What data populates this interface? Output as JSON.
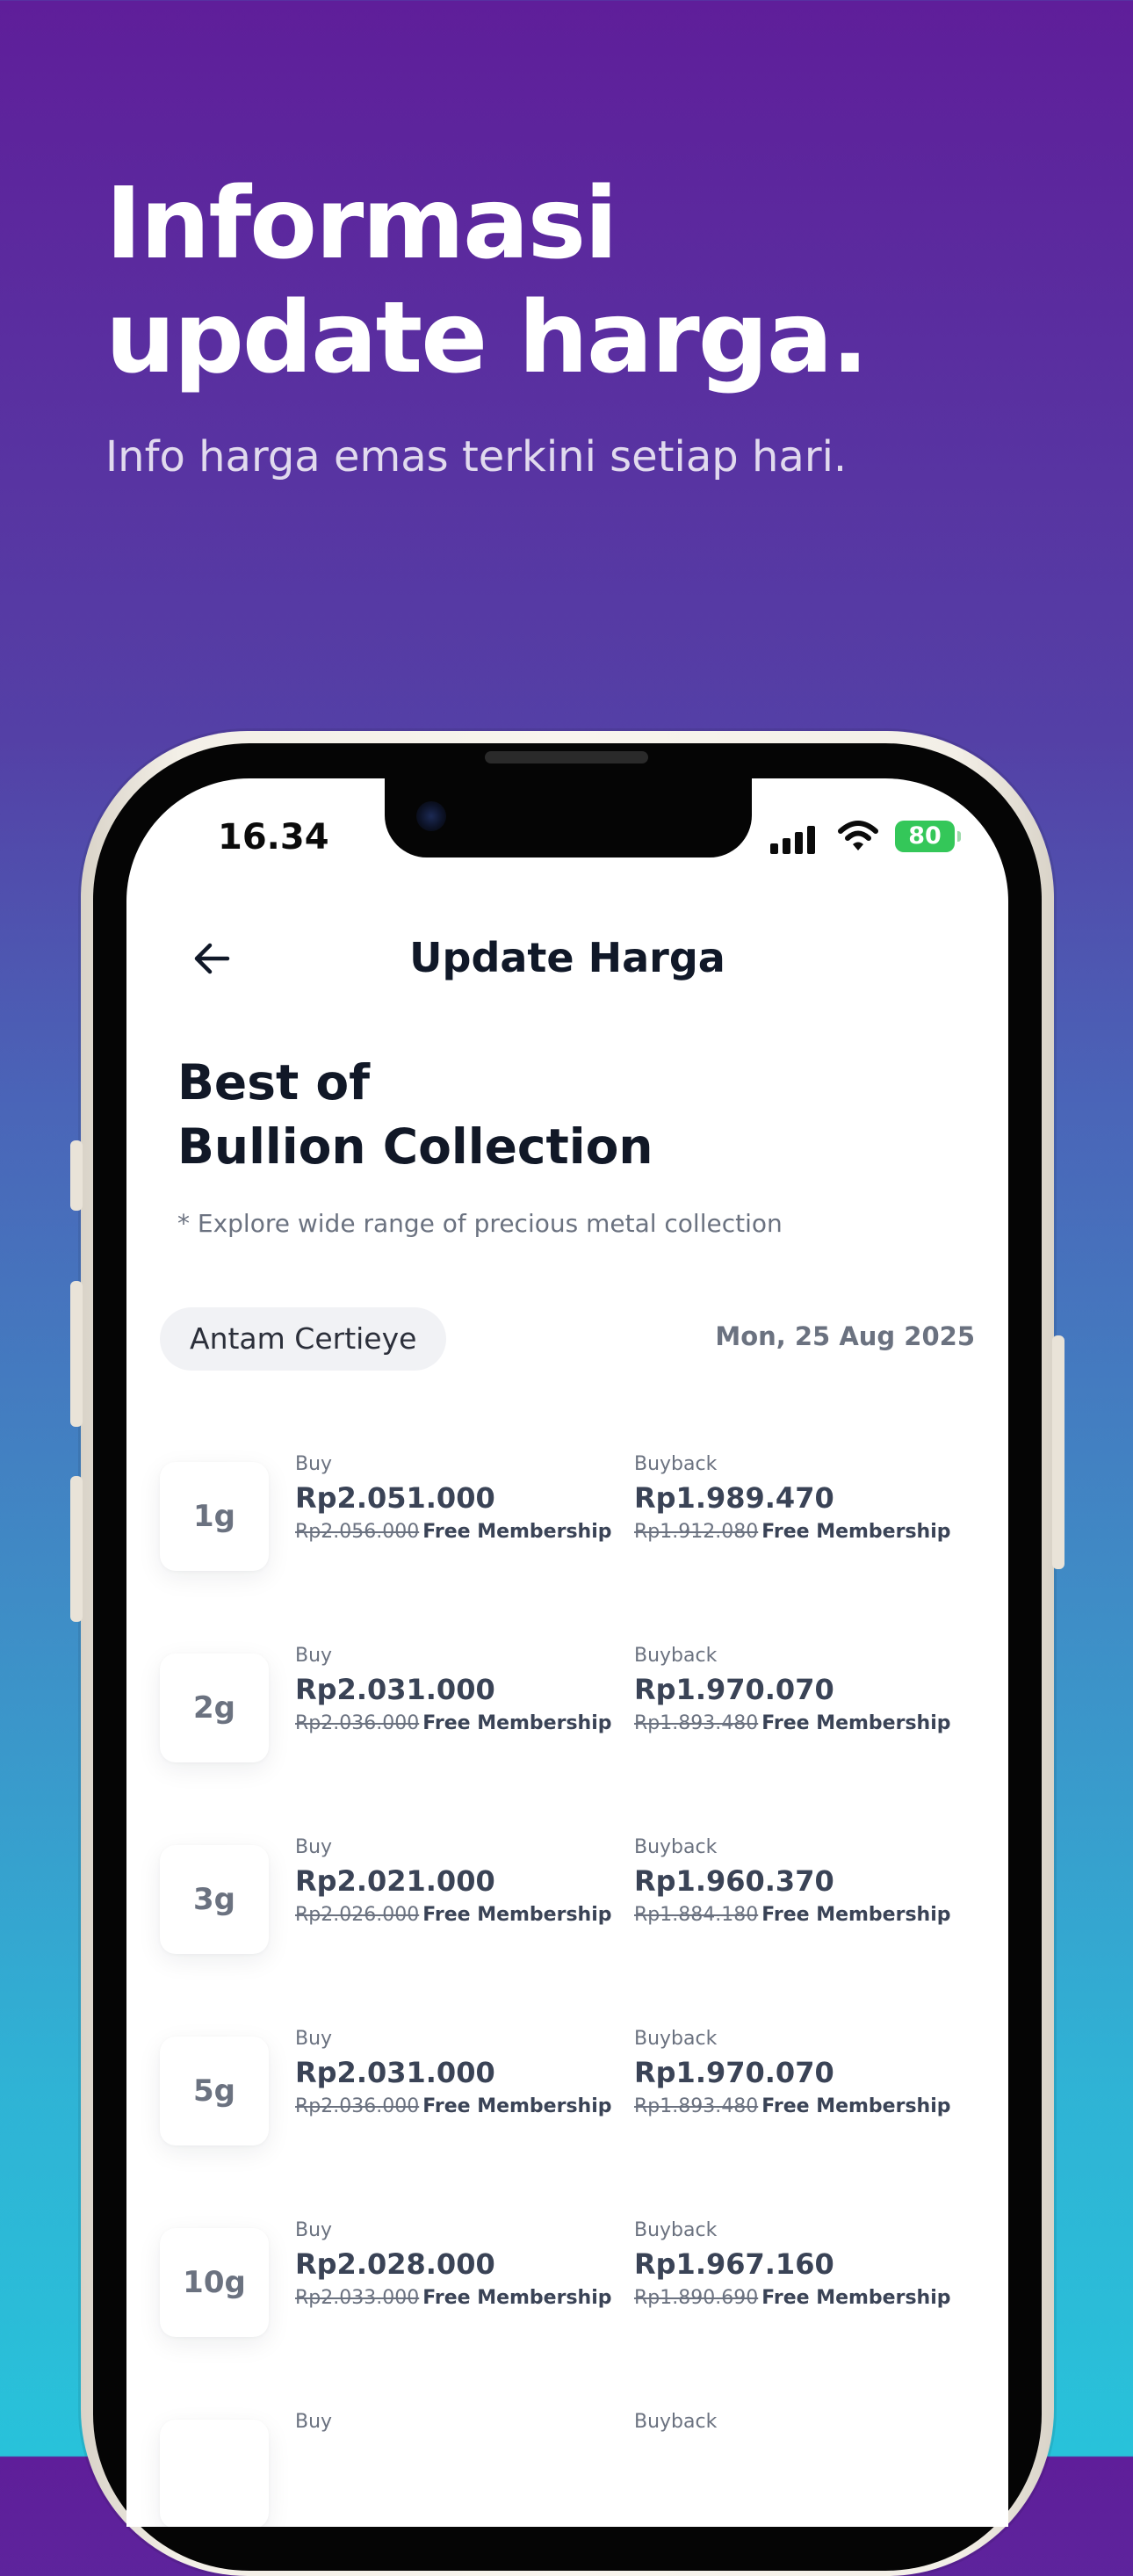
{
  "promo": {
    "title_line1": "Informasi",
    "title_line2": "update harga.",
    "subtitle": "Info harga emas terkini setiap hari."
  },
  "status_bar": {
    "time": "16.34",
    "battery": "80",
    "icons": [
      "signal-icon",
      "wifi-icon",
      "battery-icon"
    ]
  },
  "header": {
    "title": "Update Harga",
    "back_icon": "arrow-left-icon"
  },
  "section": {
    "title_line1": "Best of",
    "title_line2": "Bullion Collection",
    "note": "* Explore wide range of precious metal collection"
  },
  "filter": {
    "brand": "Antam Certieye",
    "date": "Mon, 25 Aug 2025"
  },
  "prices": [
    {
      "weight": "1g",
      "buy_label": "Buy",
      "buy": "Rp2.051.000",
      "buy_old": "Rp2.056.000",
      "buy_note": "Free Membership",
      "buyback_label": "Buyback",
      "buyback": "Rp1.989.470",
      "buyback_old": "Rp1.912.080",
      "buyback_note": "Free Membership"
    },
    {
      "weight": "2g",
      "buy_label": "Buy",
      "buy": "Rp2.031.000",
      "buy_old": "Rp2.036.000",
      "buy_note": "Free Membership",
      "buyback_label": "Buyback",
      "buyback": "Rp1.970.070",
      "buyback_old": "Rp1.893.480",
      "buyback_note": "Free Membership"
    },
    {
      "weight": "3g",
      "buy_label": "Buy",
      "buy": "Rp2.021.000",
      "buy_old": "Rp2.026.000",
      "buy_note": "Free Membership",
      "buyback_label": "Buyback",
      "buyback": "Rp1.960.370",
      "buyback_old": "Rp1.884.180",
      "buyback_note": "Free Membership"
    },
    {
      "weight": "5g",
      "buy_label": "Buy",
      "buy": "Rp2.031.000",
      "buy_old": "Rp2.036.000",
      "buy_note": "Free Membership",
      "buyback_label": "Buyback",
      "buyback": "Rp1.970.070",
      "buyback_old": "Rp1.893.480",
      "buyback_note": "Free Membership"
    },
    {
      "weight": "10g",
      "buy_label": "Buy",
      "buy": "Rp2.028.000",
      "buy_old": "Rp2.033.000",
      "buy_note": "Free Membership",
      "buyback_label": "Buyback",
      "buyback": "Rp1.967.160",
      "buyback_old": "Rp1.890.690",
      "buyback_note": "Free Membership"
    },
    {
      "weight": "",
      "buy_label": "Buy",
      "buy": "",
      "buy_old": "",
      "buy_note": "",
      "buyback_label": "Buyback",
      "buyback": "",
      "buyback_old": "",
      "buyback_note": ""
    }
  ],
  "colors": {
    "gradient_top": "#5f1e9a",
    "gradient_bottom": "#28c2da",
    "battery_green": "#34c759",
    "text_dark": "#111827",
    "text_muted": "#6b7280"
  }
}
